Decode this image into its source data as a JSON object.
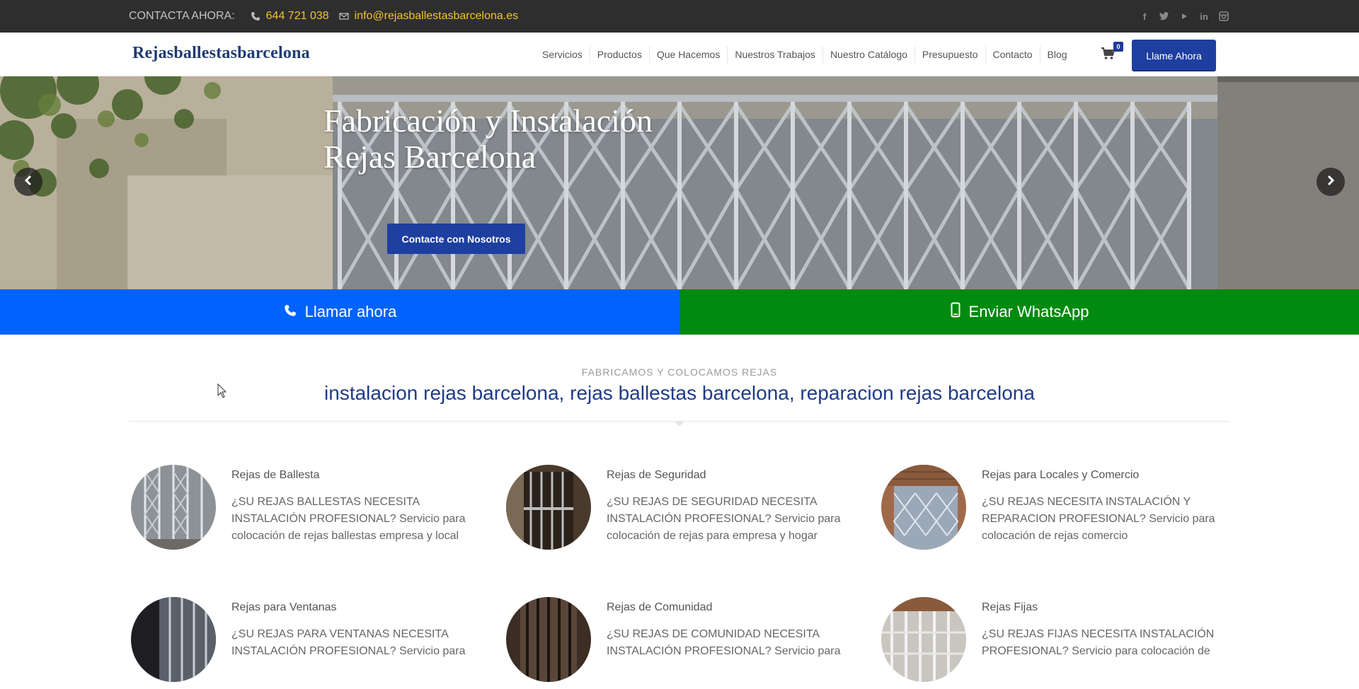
{
  "topbar": {
    "contact_label": "CONTACTA AHORA:",
    "phone": "644 721 038",
    "email": "info@rejasballestasbarcelona.es",
    "social": [
      "facebook-icon",
      "twitter-icon",
      "youtube-icon",
      "linkedin-icon",
      "instagram-icon"
    ]
  },
  "header": {
    "logo": "Rejasballestasbarcelona",
    "nav": [
      "Servicios",
      "Productos",
      "Que Hacemos",
      "Nuestros Trabajos",
      "Nuestro Catálogo",
      "Presupuesto",
      "Contacto",
      "Blog"
    ],
    "cart_count": "0",
    "call_button": "Llame Ahora"
  },
  "hero": {
    "title_line1": "Fabricación y Instalación",
    "title_line2": "Rejas Barcelona",
    "button": "Contacte con Nosotros"
  },
  "cta": {
    "call": "Llamar ahora",
    "whatsapp": "Enviar WhatsApp"
  },
  "section": {
    "kicker": "FABRICAMOS Y COLOCAMOS REJAS",
    "title": "instalacion rejas barcelona, rejas ballestas barcelona, reparacion rejas barcelona"
  },
  "services": [
    {
      "title": "Rejas de Ballesta",
      "desc": "¿SU REJAS BALLESTAS NECESITA INSTALACIÓN PROFESIONAL? Servicio para colocación de rejas ballestas empresa y local"
    },
    {
      "title": "Rejas de Seguridad",
      "desc": "¿SU REJAS DE SEGURIDAD NECESITA INSTALACIÓN PROFESIONAL? Servicio para colocación de rejas para empresa y hogar"
    },
    {
      "title": "Rejas para Locales y Comercio",
      "desc": "¿SU REJAS NECESITA INSTALACIÓN Y REPARACION PROFESIONAL? Servicio para colocación de rejas comercio"
    },
    {
      "title": "Rejas para Ventanas",
      "desc": "¿SU REJAS PARA VENTANAS NECESITA INSTALACIÓN PROFESIONAL? Servicio para"
    },
    {
      "title": "Rejas de Comunidad",
      "desc": "¿SU REJAS DE COMUNIDAD NECESITA INSTALACIÓN PROFESIONAL? Servicio para"
    },
    {
      "title": "Rejas Fijas",
      "desc": "¿SU REJAS FIJAS NECESITA INSTALACIÓN PROFESIONAL? Servicio para colocación de"
    }
  ],
  "colors": {
    "topbar": "#2e2e2e",
    "accent_yellow": "#f1c232",
    "brand_blue": "#1e3fa0",
    "call_blue": "#0062ff",
    "whatsapp_green": "#008a0f"
  }
}
